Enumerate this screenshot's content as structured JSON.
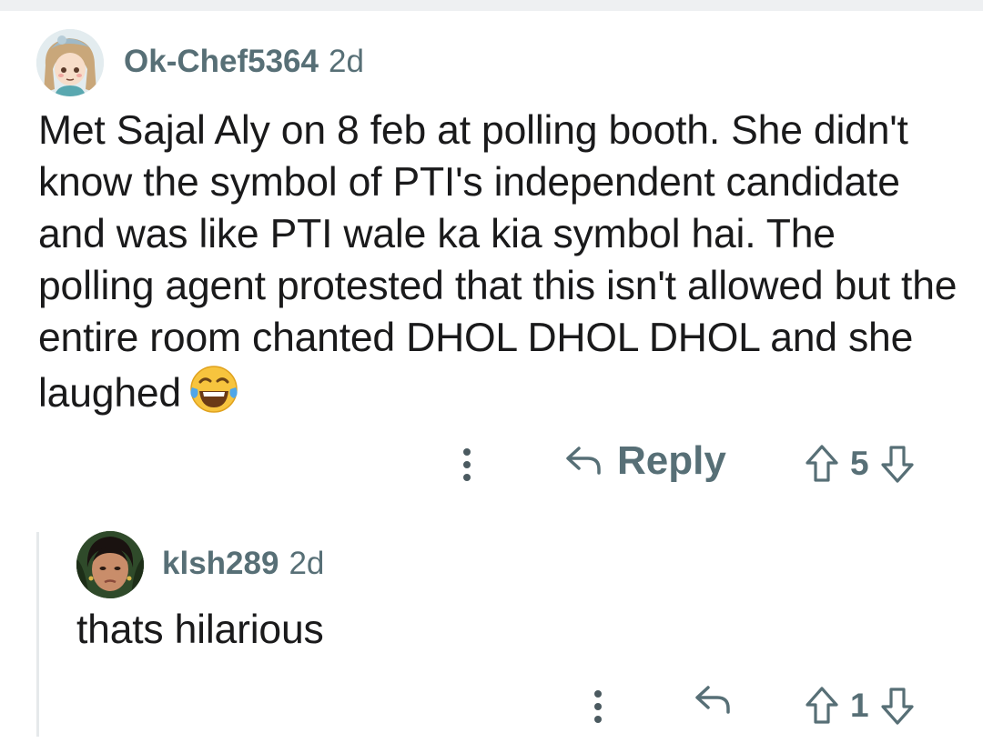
{
  "parent_comment": {
    "username": "Ok-Chef5364",
    "time": "2d",
    "body": "Met Sajal Aly on 8 feb at polling booth. She didn't know the symbol of PTI's independent candidate and was like PTI wale ka kia symbol hai. The polling agent protested that this isn't allowed but the entire room chanted DHOL DHOL DHOL and she laughed",
    "emoji": "face-with-tears-of-joy",
    "reply_label": "Reply",
    "score": "5"
  },
  "reply_comment": {
    "username": "klsh289",
    "time": "2d",
    "body": "thats hilarious",
    "score": "1"
  },
  "colors": {
    "meta_text": "#576f76",
    "body_text": "#1a1a1b",
    "thread_line": "#e6e9eb",
    "top_strip": "#eef0f2"
  },
  "icons": [
    "more-options-icon",
    "reply-arrow-icon",
    "upvote-arrow-icon",
    "downvote-arrow-icon"
  ]
}
